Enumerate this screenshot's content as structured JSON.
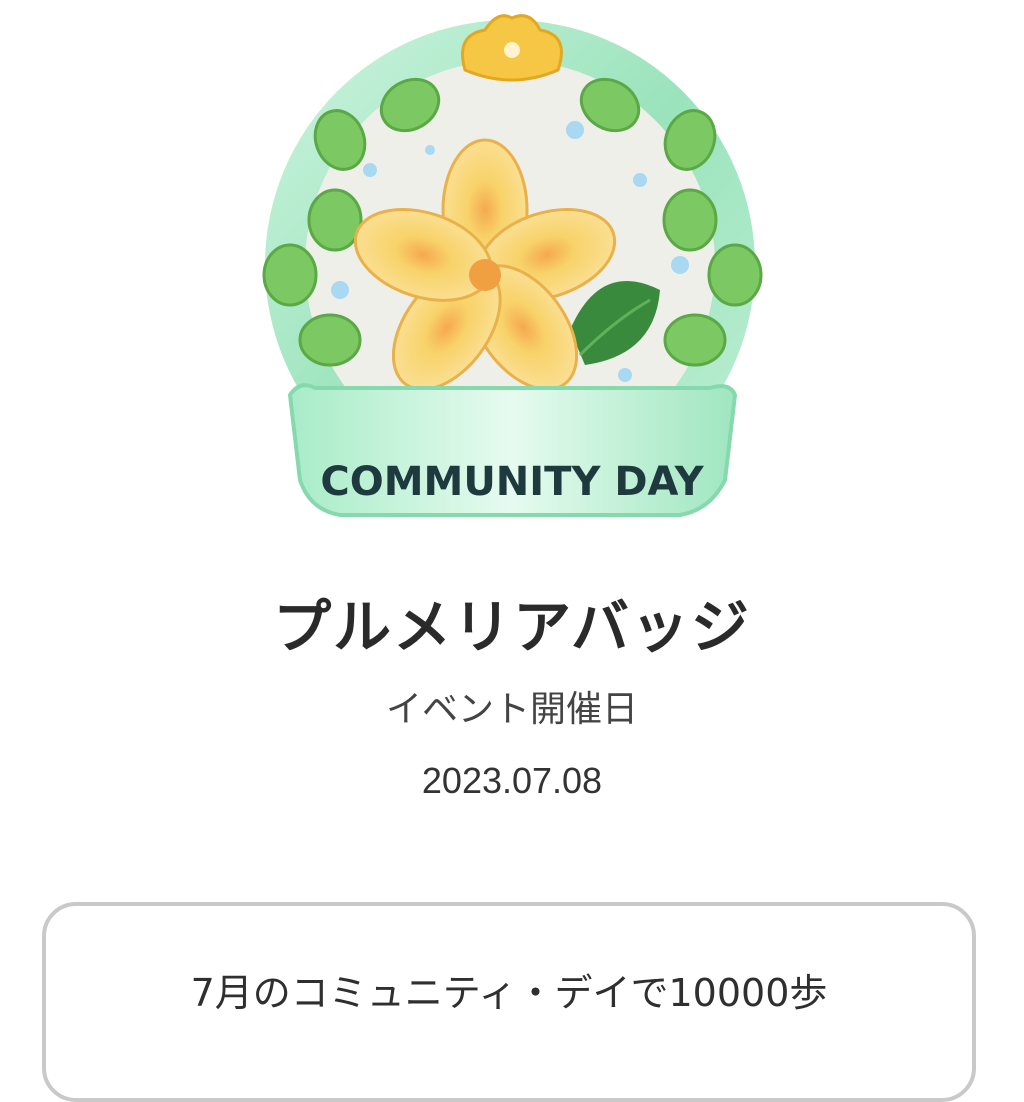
{
  "badge": {
    "ribbon_text": "COMMUNITY DAY",
    "icon": "plumeria-badge-icon"
  },
  "title": "プルメリアバッジ",
  "event_date": {
    "label": "イベント開催日",
    "value": "2023.07.08"
  },
  "info_card": {
    "text": "7月のコミュニティ・デイで10000歩"
  },
  "colors": {
    "title": "#2a2a2a",
    "card_border": "#c9c9c9",
    "badge_frame": "#9be3b8",
    "badge_leaves": "#7cc862",
    "flower": "#f7cf5c",
    "ribbon_text": "#1f3a3e"
  }
}
